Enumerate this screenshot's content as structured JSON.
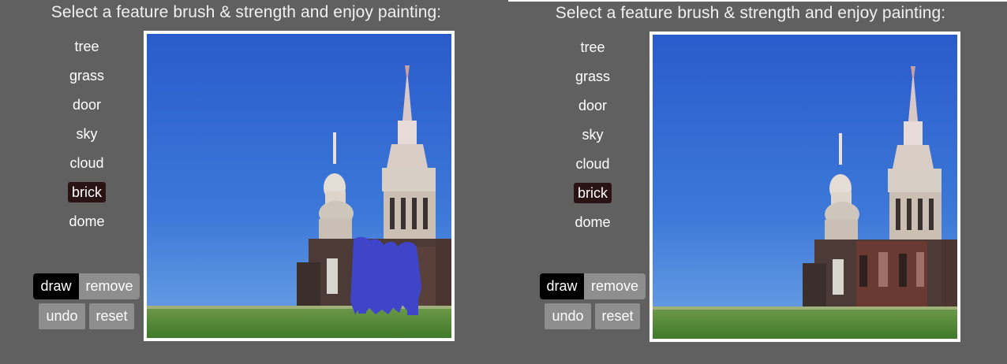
{
  "instruction": "Select a feature brush & strength and enjoy painting:",
  "brushes": [
    "tree",
    "grass",
    "door",
    "sky",
    "cloud",
    "brick",
    "dome"
  ],
  "selected_brush": "brick",
  "mode_buttons": {
    "draw": "draw",
    "remove": "remove"
  },
  "action_buttons": {
    "undo": "undo",
    "reset": "reset"
  },
  "colors": {
    "background": "#606060",
    "selected": "#2a1314",
    "active_button": "#000000",
    "button": "#8e8e8e",
    "stroke": "#3f44c8"
  }
}
